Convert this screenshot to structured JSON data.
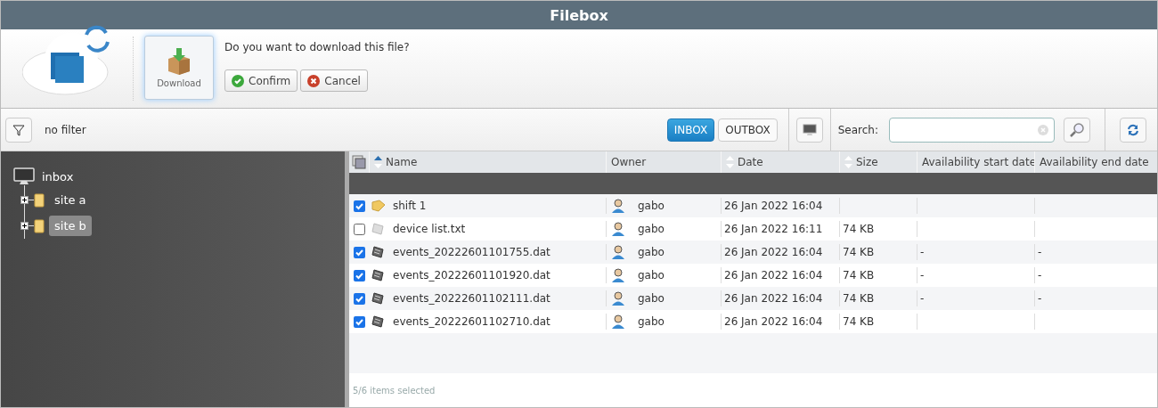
{
  "window": {
    "title": "Filebox"
  },
  "prompt": {
    "action": "Download",
    "question": "Do you want to download this file?",
    "buttons": [
      "Confirm",
      "Cancel"
    ]
  },
  "toolbar": {
    "filter": "no filter",
    "tabs": [
      {
        "label": "INBOX",
        "selected": true
      },
      {
        "label": "OUTBOX",
        "selected": false
      }
    ],
    "search_label": "Search:"
  },
  "tree": {
    "label": "inbox",
    "children": [
      {
        "label": "site a",
        "selected": false
      },
      {
        "label": "site b",
        "selected": true
      }
    ]
  },
  "table": {
    "columns": [
      {
        "label": "Name",
        "sortable": true,
        "sorted": true
      },
      {
        "label": "Owner"
      },
      {
        "label": "Date",
        "sortable": true,
        "sorted": false
      },
      {
        "label": "Size",
        "sortable": true,
        "sorted": false
      },
      {
        "label": "Availability start date"
      },
      {
        "label": "Availability end date"
      }
    ],
    "rows": [
      {
        "kind": "folder",
        "checked": true,
        "name": "shift 1",
        "owner": "gabo",
        "date": "26 Jan 2022 16:04"
      },
      {
        "kind": "text",
        "checked": false,
        "name": "device list.txt",
        "owner": "gabo",
        "date": "26 Jan 2022 16:11",
        "size": "74 KB"
      },
      {
        "kind": "data",
        "checked": true,
        "name": "events_20222601101755.dat",
        "owner": "gabo",
        "date": "26 Jan 2022 16:04",
        "size": "74 KB",
        "start": "-",
        "end": "-"
      },
      {
        "kind": "data",
        "checked": true,
        "name": "events_20222601101920.dat",
        "owner": "gabo",
        "date": "26 Jan 2022 16:04",
        "size": "74 KB",
        "start": "-",
        "end": "-"
      },
      {
        "kind": "data",
        "checked": true,
        "name": "events_20222601102111.dat",
        "owner": "gabo",
        "date": "26 Jan 2022 16:04",
        "size": "74 KB",
        "start": "-",
        "end": "-"
      },
      {
        "kind": "data",
        "checked": true,
        "name": "events_20222601102710.dat",
        "owner": "gabo",
        "date": "26 Jan 2022 16:04",
        "size": "74 KB"
      }
    ],
    "status": "5/6 items selected"
  }
}
